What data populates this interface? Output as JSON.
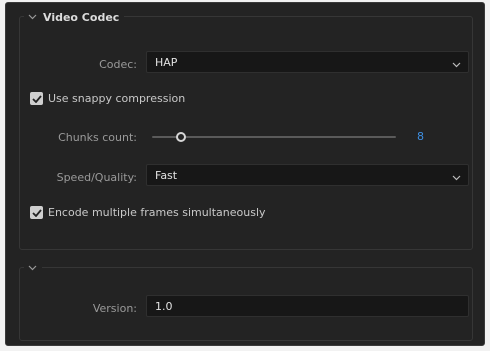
{
  "video_codec_group": {
    "title": "Video Codec",
    "codec": {
      "label": "Codec:",
      "value": "HAP"
    },
    "snappy": {
      "label": "Use snappy compression",
      "checked": true
    },
    "chunks": {
      "label": "Chunks count:",
      "value": "8",
      "level": 0.12
    },
    "speed_quality": {
      "label": "Speed/Quality:",
      "value": "Fast"
    },
    "encode_multi": {
      "label": "Encode multiple frames simultaneously",
      "checked": true
    }
  },
  "second_group": {
    "version": {
      "label": "Version:",
      "value": "1.0"
    }
  },
  "icons": {
    "group_toggle": "chevron-down-icon",
    "dropdown": "chevron-down-icon",
    "checkbox": "checkmark-icon"
  },
  "colors": {
    "panel_bg": "#232323",
    "field_bg": "#171717",
    "accent_value": "#3d8ee0",
    "label_text": "#9a9a9a"
  }
}
